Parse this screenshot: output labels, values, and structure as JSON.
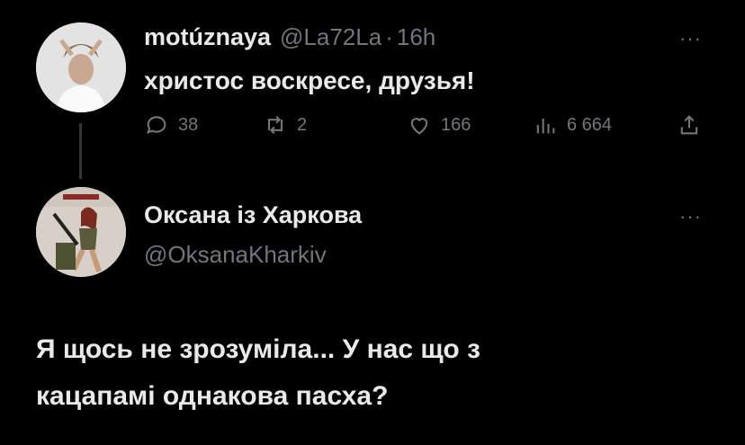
{
  "tweet": {
    "display_name": "motúznaya",
    "handle": "@La72La",
    "separator": "·",
    "time": "16h",
    "text": "христос воскресе, друзья!",
    "more": "···",
    "actions": {
      "replies": "38",
      "retweets": "2",
      "likes": "166",
      "views": "6 664"
    }
  },
  "reply": {
    "display_name": "Оксана із Харкова",
    "handle": "@OksanaKharkiv",
    "more": "···",
    "text_line1": "Я щось не зрозуміла... У нас що з",
    "text_line2": "кацапамі однакова пасха?"
  },
  "colors": {
    "background": "#000000",
    "text": "#e7e9ea",
    "muted": "#71767b",
    "thread_line": "#333639"
  },
  "icons": [
    "reply-icon",
    "retweet-icon",
    "like-icon",
    "views-icon",
    "share-icon",
    "more-icon"
  ]
}
